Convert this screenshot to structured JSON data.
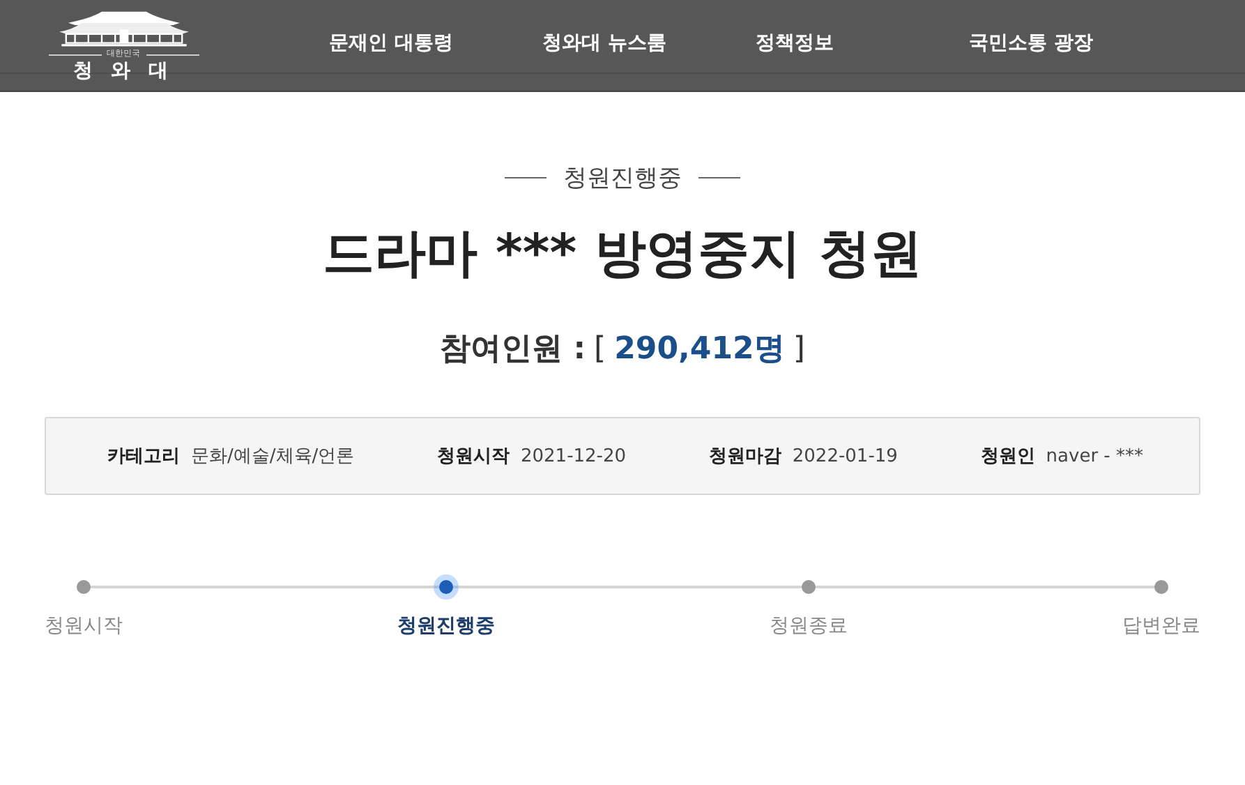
{
  "header": {
    "logo": {
      "subtitle": "대한민국",
      "name": "청 와 대"
    },
    "nav": [
      {
        "label": "문재인 대통령"
      },
      {
        "label": "청와대 뉴스룸"
      },
      {
        "label": "정책정보"
      },
      {
        "label": "국민소통 광장"
      }
    ]
  },
  "petition": {
    "status": "청원진행중",
    "title": "드라마 *** 방영중지 청원",
    "participants_label": "참여인원 :",
    "participants_open": "[",
    "participants_count": "290,412명",
    "participants_close": "]"
  },
  "info": [
    {
      "label": "카테고리",
      "value": "문화/예술/체육/언론"
    },
    {
      "label": "청원시작",
      "value": "2021-12-20"
    },
    {
      "label": "청원마감",
      "value": "2022-01-19"
    },
    {
      "label": "청원인",
      "value": "naver - ***"
    }
  ],
  "steps": [
    {
      "label": "청원시작",
      "selected": false
    },
    {
      "label": "청원진행중",
      "selected": true
    },
    {
      "label": "청원종료",
      "selected": false
    },
    {
      "label": "답변완료",
      "selected": false
    }
  ]
}
